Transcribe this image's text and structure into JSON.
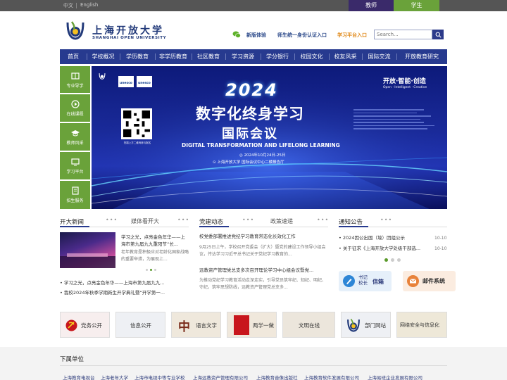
{
  "topbar": {
    "lang_cn": "中文",
    "lang_en": "English",
    "role_teacher": "教师",
    "role_student": "学生"
  },
  "header": {
    "logo_cn": "上海开放大学",
    "logo_en": "SHANGHAI OPEN UNIVERSITY",
    "links": [
      "新版体验",
      "师生统一身份认证入口",
      "学习平台入口"
    ],
    "search_placeholder": "Search..."
  },
  "nav": [
    "首页",
    "学校概况",
    "学历教育",
    "非学历教育",
    "社区教育",
    "学习资源",
    "学分银行",
    "校园文化",
    "校友风采",
    "国际交流",
    "开放教育研究"
  ],
  "sidebar": [
    "专业导学",
    "在线课程",
    "教师风采",
    "学习平台",
    "招生服务"
  ],
  "banner": {
    "year": "2024",
    "title1": "数字化终身学习",
    "title2": "国际会议",
    "title_en": "DIGITAL TRANSFORMATION AND LIFELONG LEARNING",
    "date": "2024年10月24日-25日",
    "venue": "上海开放大学 国际会议中心二楼报告厅",
    "slogan": "开放·智能·创造",
    "slogan_en": "Open · Intelligent · Creative",
    "qr_caption": "扫描上方二维码参与报名",
    "unesco1": "unesco",
    "unesco2": "unesco"
  },
  "news": {
    "title": "开大新闻",
    "title_alt": "媒体看开大",
    "headline": "学习之光，点亮金色年华——上海市第九届九九重阳节“长...",
    "summary": "老年教育是积极应对老龄化国家战略的重要举措，为展现上...",
    "items": [
      "学习之光，点亮金色年华——上海市第九届九九...",
      "我校2024年秋季学期新生开学典礼暨“开学第一..."
    ]
  },
  "party": {
    "title": "党建动态",
    "title_alt": "政策速递",
    "h1": "校党委部署推进党纪学习教育常态化长效化工作",
    "s1": "9月25日上午，学校召开党委会（扩大）暨党的建设工作领导小组会议，传达学习习近平总书记关于党纪学习教育的...",
    "h2": "远教资产管理党总支多次召开理论学习中心组会议暨党...",
    "s2": "为推动党纪学习教育活动走深走实，引导党员筑牢纪、知纪、明纪、守纪，筑牢思想防线，远教资产管理党总支多..."
  },
  "notice": {
    "title": "通知公告",
    "items": [
      {
        "text": "2024因公出国（境）团组公示",
        "date": "10-10"
      },
      {
        "text": "关于征求《上海开放大学处级干部选...",
        "date": "10-10"
      }
    ],
    "btn_letter_line1": "书记",
    "btn_letter_line2": "校长",
    "btn_letter_line3": "信箱",
    "btn_mail": "邮件系统"
  },
  "tiles": [
    "党务公开",
    "信息公开",
    "语言文字",
    "两学一做",
    "文明在线",
    "部门网站",
    "网络安全与信息化"
  ],
  "units": {
    "title": "下属单位",
    "items": [
      "上海教育电视台",
      "上海老年大学",
      "上海市电视中等专业学校",
      "上海远教资产管理有限公司",
      "上海教育音像出版社",
      "上海教育软件发展有限公司",
      "上海易班企业发展有限公司"
    ]
  },
  "colors": {
    "nav": "#273a8f",
    "sidebar": "#6aa23a",
    "topbar": "#555555",
    "teacher": "#3a2a6a",
    "student": "#6aa23a"
  }
}
